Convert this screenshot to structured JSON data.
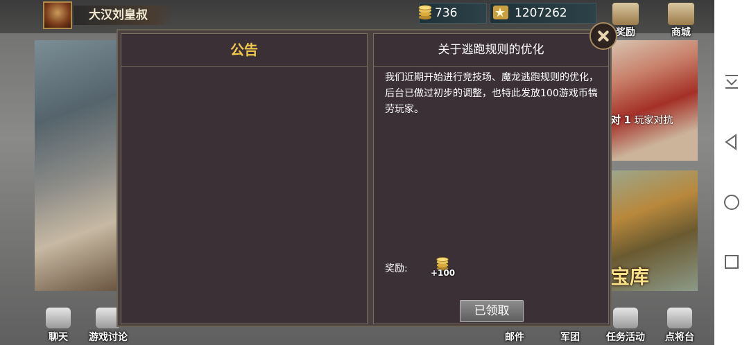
{
  "player": {
    "name": "大汉刘皇叔"
  },
  "currencies": [
    {
      "icon": "gold-coin-icon",
      "value": "736"
    },
    {
      "icon": "star-icon",
      "value": "1207262"
    }
  ],
  "hud_buttons": [
    {
      "name": "reward",
      "label": "奖励",
      "icon": "gift-icon"
    },
    {
      "name": "shop",
      "label": "商城",
      "icon": "pagoda-icon"
    }
  ],
  "side_banners": {
    "pvp": {
      "prefix": "对",
      "num": "1",
      "label": "玩家对抗"
    },
    "treasure": {
      "label": "宝库"
    }
  },
  "dialog": {
    "left_title": "公告",
    "right_title": "关于逃跑规则的优化",
    "body": "我们近期开始进行竞技场、魔龙逃跑规则的优化，后台已做过初步的调整，也特此发放100游戏币犒劳玩家。",
    "reward_label": "奖励:",
    "reward_amount": "+100",
    "claim_button": "已领取"
  },
  "bottom_nav": [
    {
      "name": "chat",
      "label": "聊天"
    },
    {
      "name": "forum",
      "label": "游戏讨论"
    },
    {
      "name": "mail",
      "label": "邮件"
    },
    {
      "name": "legion",
      "label": "军团"
    },
    {
      "name": "tasks",
      "label": "任务活动"
    },
    {
      "name": "general-stage",
      "label": "点将台"
    }
  ],
  "colors": {
    "accent_title": "#f0c84a",
    "panel_bg": "#3a3036",
    "border": "#7a6f60"
  }
}
